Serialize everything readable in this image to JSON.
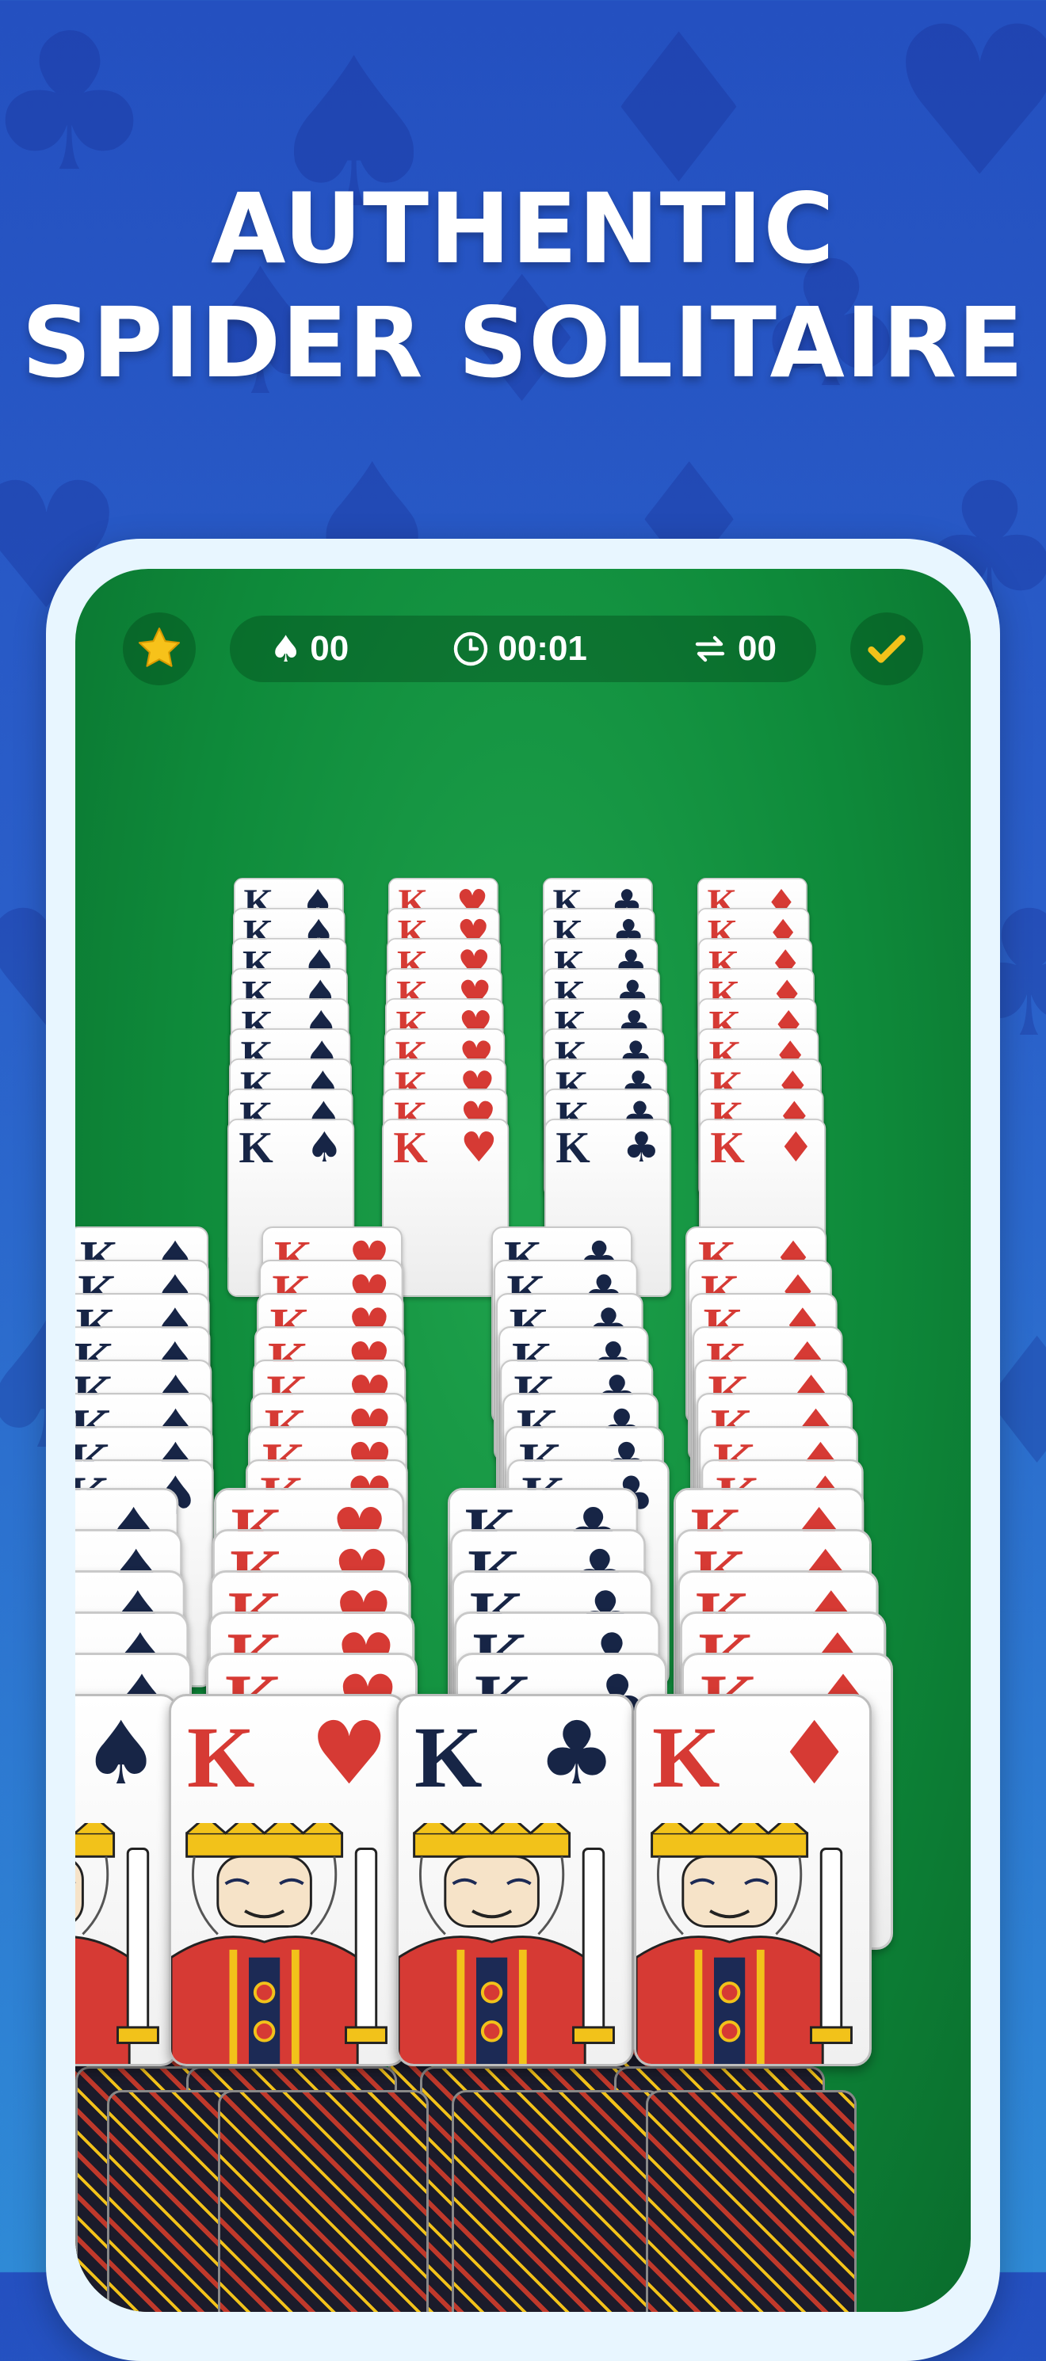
{
  "headline": {
    "line1": "AUTHENTIC",
    "line2": "SPIDER SOLITAIRE"
  },
  "topbar": {
    "spades_count": "00",
    "timer": "00:01",
    "moves": "00"
  },
  "card_rank": "K",
  "icons": {
    "star": "star-icon",
    "spade": "spade-icon",
    "clock": "clock-icon",
    "swap": "swap-icon",
    "check": "check-icon"
  },
  "colors": {
    "background_blue": "#2a5ec9",
    "table_green": "#0e8a3a",
    "frame": "#e8f6ff",
    "card_black": "#172546",
    "card_red": "#d63a34",
    "star_gold": "#f7c21a",
    "check_gold": "#f2c21a"
  },
  "columns": [
    {
      "suit": "♠",
      "color": "black"
    },
    {
      "suit": "♥",
      "color": "red"
    },
    {
      "suit": "♣",
      "color": "black"
    },
    {
      "suit": "♦",
      "color": "red"
    }
  ]
}
